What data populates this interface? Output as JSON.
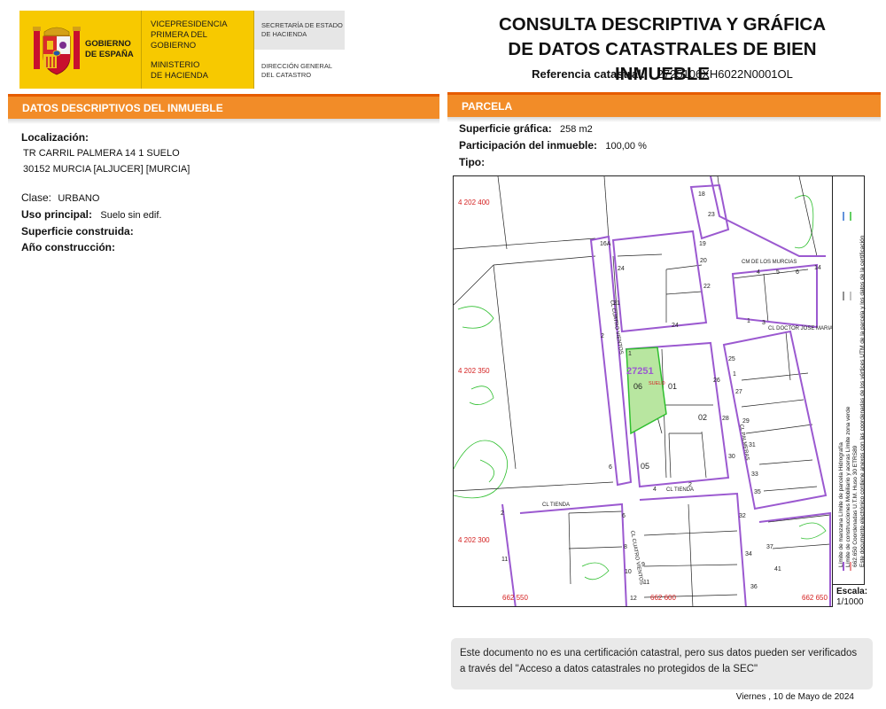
{
  "header": {
    "gov_line1": "GOBIERNO",
    "gov_line2": "DE ESPAÑA",
    "vice_line1": "VICEPRESIDENCIA",
    "vice_line2": "PRIMERA DEL GOBIERNO",
    "min_line1": "MINISTERIO",
    "min_line2": "DE HACIENDA",
    "sec_line1": "SECRETARÍA DE ESTADO",
    "sec_line2": "DE HACIENDA",
    "dir_line1": "DIRECCIÓN GENERAL",
    "dir_line2": "DEL CATASTRO"
  },
  "document": {
    "title_line1": "CONSULTA DESCRIPTIVA Y GRÁFICA",
    "title_line2": "DE DATOS CATASTRALES DE BIEN INMUEBLE",
    "ref_label": "Referencia catastral:",
    "ref_value": "2725106XH6022N0001OL"
  },
  "inmueble": {
    "section_title": "DATOS DESCRIPTIVOS DEL INMUEBLE",
    "localizacion_label": "Localización:",
    "address_line1": "TR CARRIL PALMERA 14 1 SUELO",
    "address_line2": "30152 MURCIA [ALJUCER] [MURCIA]",
    "clase_label": "Clase:",
    "clase_value": "URBANO",
    "uso_label": "Uso principal:",
    "uso_value": "Suelo sin edif.",
    "superficie_label": "Superficie construida:",
    "anio_label": "Año construcción:"
  },
  "parcela": {
    "section_title": "PARCELA",
    "superficie_label": "Superficie gráfica:",
    "superficie_value": "258 m2",
    "participacion_label": "Participación del inmueble:",
    "participacion_value": "100,00 %",
    "tipo_label": "Tipo:"
  },
  "map": {
    "parcel_ref": "27251",
    "suelo_label": "SUELO",
    "y_labels": [
      "4 202 400",
      "4 202 350",
      "4 202 300"
    ],
    "x_labels": [
      "662 550",
      "662 600",
      "662 650"
    ],
    "plot_numbers": [
      "06",
      "01",
      "02",
      "05"
    ],
    "street_labels": [
      "CM DE LOS MURCIAS",
      "CL CUATRO VIENTOS",
      "CL DOCTOR JOSE MARIANO R",
      "CL TIENDA",
      "CL TIENDA",
      "CL PALMERAS",
      "CL CUATRO VIENTOS"
    ],
    "house_numbers": [
      "16A",
      "18",
      "19",
      "20",
      "21",
      "22",
      "23",
      "24",
      "2",
      "1",
      "3",
      "4",
      "5",
      "6",
      "14",
      "25",
      "26",
      "27",
      "28",
      "29",
      "30",
      "31",
      "33",
      "35",
      "37",
      "32",
      "34",
      "36",
      "41",
      "2",
      "4",
      "6",
      "8",
      "9",
      "10",
      "11",
      "12",
      "1",
      "24",
      "1"
    ],
    "legend_line1": "Límite de manzana   Límite de parcela   Hidrografía",
    "legend_line2": "Límite de construcciones   Mobiliario y aceras   Límite zona verde",
    "legend_line3": "662.650 Coordenadas U.T.M. Huso 30 ETRS89",
    "legend_line4": "Este documento electrónico contiene anexos con las coordenadas de los vértices UTM de la parcela y los datos de la certificación",
    "escala_label": "Escala:",
    "escala_value": "1/1000",
    "colors": {
      "manzana": "#9b59d0",
      "parcela": "#222222",
      "zona_verde": "#2fbf2f",
      "highlight": "#b8e6a0",
      "labels": "#d42020"
    }
  },
  "footer": {
    "notice": "Este documento no es una certificación catastral, pero sus datos pueden ser verificados a través del \"Acceso a datos catastrales no protegidos de la SEC\"",
    "date": "Viernes , 10 de Mayo de 2024"
  }
}
